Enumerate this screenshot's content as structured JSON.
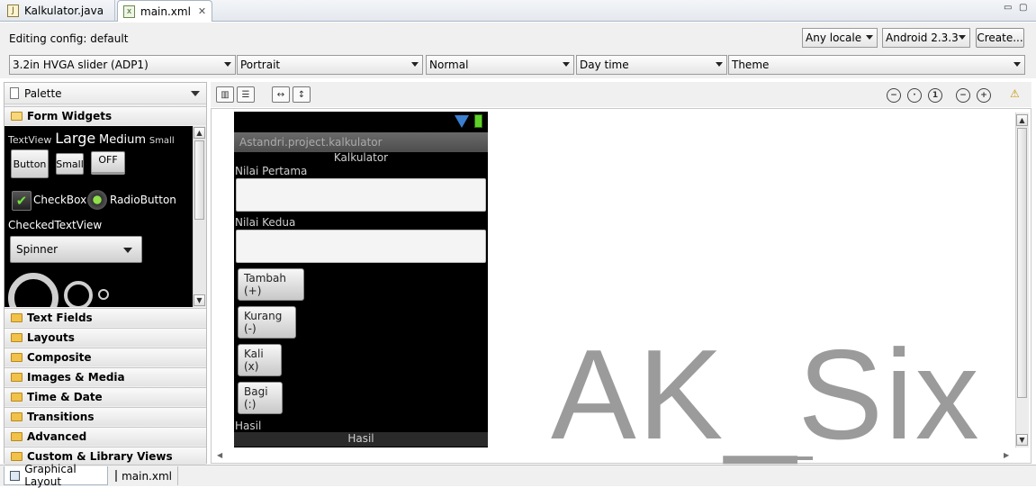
{
  "editor_tabs": [
    {
      "label": "Kalkulator.java",
      "icon": "java-file-icon",
      "active": false
    },
    {
      "label": "main.xml",
      "icon": "xml-file-icon",
      "active": true,
      "closable": true
    }
  ],
  "config": {
    "editing_label": "Editing config:",
    "editing_value": "default",
    "locale": "Any locale",
    "target": "Android 2.3.3",
    "create_label": "Create...",
    "device": "3.2in HVGA slider (ADP1)",
    "orientation": "Portrait",
    "dock_mode": "Normal",
    "night_mode": "Day time",
    "theme": "Theme"
  },
  "palette": {
    "title": "Palette",
    "open_category": "Form Widgets",
    "widgets": {
      "textview": "TextView",
      "large": "Large",
      "medium": "Medium",
      "small": "Small",
      "button": "Button",
      "small_button": "Small",
      "toggle": "OFF",
      "checkbox": "CheckBox",
      "radiobutton": "RadioButton",
      "checkedtextview": "CheckedTextView",
      "spinner": "Spinner"
    },
    "categories": [
      "Text Fields",
      "Layouts",
      "Composite",
      "Images & Media",
      "Time & Date",
      "Transitions",
      "Advanced",
      "Custom & Library Views"
    ]
  },
  "phone": {
    "app_title": "Astandri.project.kalkulator",
    "heading": "Kalkulator",
    "label_first": "Nilai Pertama",
    "label_second": "Nilai Kedua",
    "btn_add": "Tambah (+)",
    "btn_sub": "Kurang (-)",
    "btn_mul": "Kali (x)",
    "btn_div": "Bagi (:)",
    "label_result": "Hasil",
    "result_value": "Hasil"
  },
  "watermark": "AK_Six",
  "bottom_tabs": [
    {
      "label": "Graphical Layout",
      "active": true
    },
    {
      "label": "main.xml",
      "active": false
    }
  ]
}
